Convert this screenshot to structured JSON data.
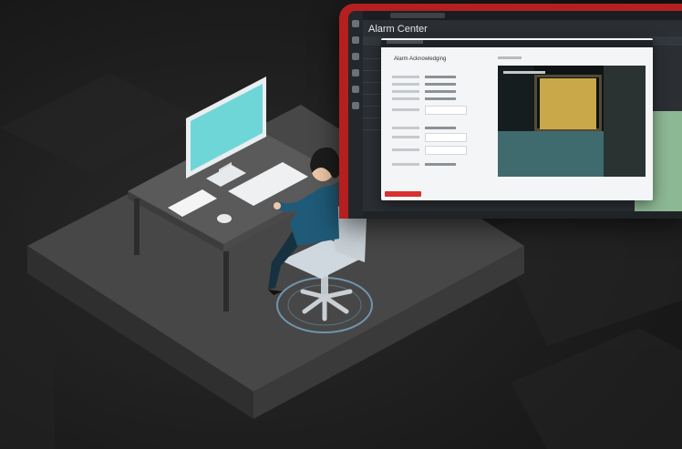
{
  "app": {
    "title": "Alarm Center",
    "dialog_title": "Alarm Acknowledging"
  },
  "colors": {
    "background": "#202020",
    "platform": "#4a4a4a",
    "monitor_screen": "#6fd6d8",
    "window_frame": "#b51f1f",
    "dialog": "#f4f5f6",
    "door": "#c9a84a",
    "floor_glow": "#7aa9c7"
  },
  "scene": {
    "illustration": "person-at-desk-workstation"
  }
}
